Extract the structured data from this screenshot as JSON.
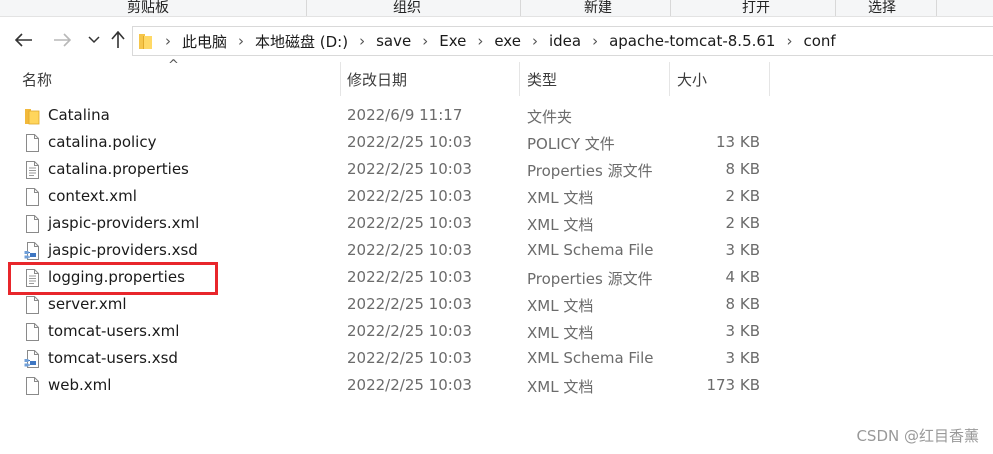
{
  "ribbon": {
    "groups": [
      "剪贴板",
      "组织",
      "新建",
      "打开",
      "选择"
    ]
  },
  "nav": {
    "back_icon": "arrow-left-icon",
    "forward_icon": "arrow-right-icon",
    "recent_icon": "chevron-down-icon",
    "up_icon": "arrow-up-icon",
    "breadcrumbs": [
      "此电脑",
      "本地磁盘 (D:)",
      "save",
      "Exe",
      "exe",
      "idea",
      "apache-tomcat-8.5.61",
      "conf"
    ]
  },
  "columns": {
    "name": "名称",
    "modified": "修改日期",
    "type": "类型",
    "size": "大小",
    "sort_indicator": "^"
  },
  "files": [
    {
      "name": "Catalina",
      "modified": "2022/6/9 11:17",
      "type": "文件夹",
      "size": "",
      "icon": "folder-icon"
    },
    {
      "name": "catalina.policy",
      "modified": "2022/2/25 10:03",
      "type": "POLICY 文件",
      "size": "13 KB",
      "icon": "file-icon"
    },
    {
      "name": "catalina.properties",
      "modified": "2022/2/25 10:03",
      "type": "Properties 源文件",
      "size": "8 KB",
      "icon": "text-file-icon"
    },
    {
      "name": "context.xml",
      "modified": "2022/2/25 10:03",
      "type": "XML 文档",
      "size": "2 KB",
      "icon": "file-icon"
    },
    {
      "name": "jaspic-providers.xml",
      "modified": "2022/2/25 10:03",
      "type": "XML 文档",
      "size": "2 KB",
      "icon": "file-icon"
    },
    {
      "name": "jaspic-providers.xsd",
      "modified": "2022/2/25 10:03",
      "type": "XML Schema File",
      "size": "3 KB",
      "icon": "schema-file-icon"
    },
    {
      "name": "logging.properties",
      "modified": "2022/2/25 10:03",
      "type": "Properties 源文件",
      "size": "4 KB",
      "icon": "text-file-icon"
    },
    {
      "name": "server.xml",
      "modified": "2022/2/25 10:03",
      "type": "XML 文档",
      "size": "8 KB",
      "icon": "file-icon"
    },
    {
      "name": "tomcat-users.xml",
      "modified": "2022/2/25 10:03",
      "type": "XML 文档",
      "size": "3 KB",
      "icon": "file-icon"
    },
    {
      "name": "tomcat-users.xsd",
      "modified": "2022/2/25 10:03",
      "type": "XML Schema File",
      "size": "3 KB",
      "icon": "schema-file-icon"
    },
    {
      "name": "web.xml",
      "modified": "2022/2/25 10:03",
      "type": "XML 文档",
      "size": "173 KB",
      "icon": "file-icon"
    }
  ],
  "highlight_color": "#e8262b",
  "watermark": "CSDN @红目香薰"
}
